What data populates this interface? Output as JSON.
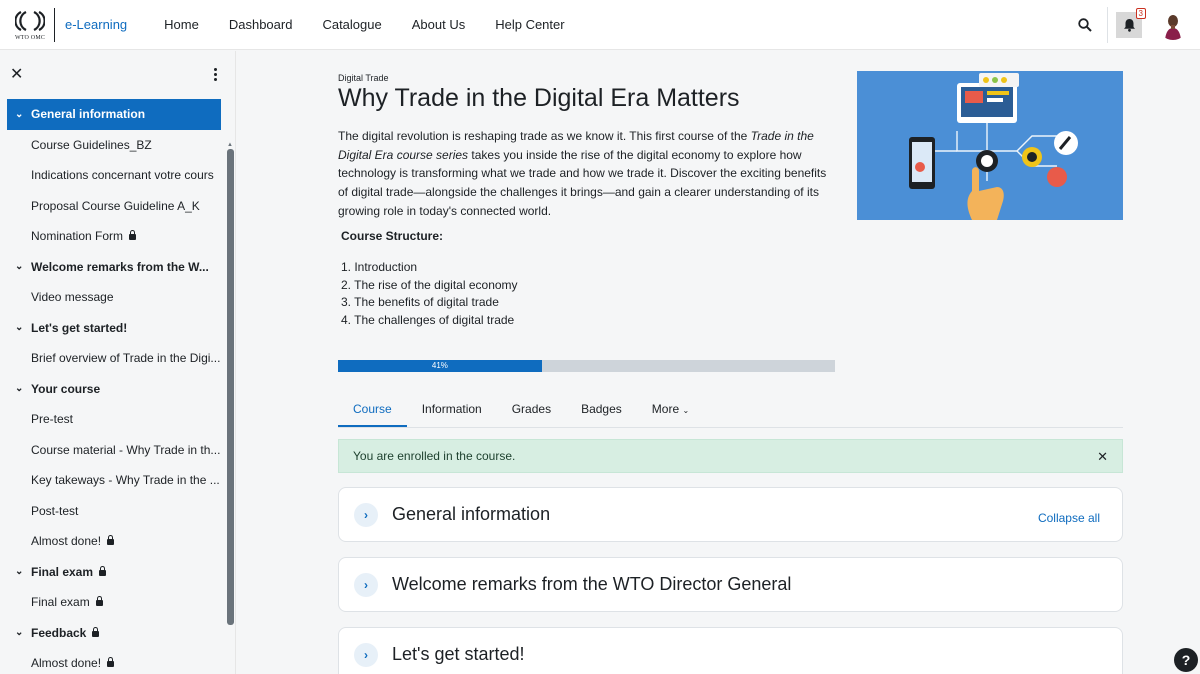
{
  "navbar": {
    "logo_small_text": "WTO OMC",
    "brand": "e-Learning",
    "links": [
      "Home",
      "Dashboard",
      "Catalogue",
      "About Us",
      "Help Center"
    ],
    "notification_count": "3"
  },
  "drawer": {
    "items": [
      {
        "type": "section",
        "label": "General information",
        "active": true,
        "locked": false
      },
      {
        "type": "activity",
        "label": "Course Guidelines_BZ",
        "locked": false
      },
      {
        "type": "activity",
        "label": "Indications concernant votre cours",
        "locked": false
      },
      {
        "type": "activity",
        "label": "Proposal Course Guideline A_K",
        "locked": false
      },
      {
        "type": "activity",
        "label": "Nomination Form",
        "locked": true
      },
      {
        "type": "section",
        "label": "Welcome remarks from the W...",
        "locked": false
      },
      {
        "type": "activity",
        "label": "Video message",
        "locked": false
      },
      {
        "type": "section",
        "label": "Let's get started!",
        "locked": false
      },
      {
        "type": "activity",
        "label": "Brief overview of Trade in the Digi...",
        "locked": false
      },
      {
        "type": "section",
        "label": "Your course",
        "locked": false
      },
      {
        "type": "activity",
        "label": "Pre-test",
        "locked": false
      },
      {
        "type": "activity",
        "label": "Course material - Why Trade in th...",
        "locked": false
      },
      {
        "type": "activity",
        "label": "Key takeways - Why Trade in the ...",
        "locked": false
      },
      {
        "type": "activity",
        "label": "Post-test",
        "locked": false
      },
      {
        "type": "activity",
        "label": "Almost done!",
        "locked": true
      },
      {
        "type": "section",
        "label": "Final exam",
        "locked": true
      },
      {
        "type": "activity",
        "label": "Final exam",
        "locked": true
      },
      {
        "type": "section",
        "label": "Feedback",
        "locked": true
      },
      {
        "type": "activity",
        "label": "Almost done!",
        "locked": true
      }
    ]
  },
  "course": {
    "category": "Digital Trade",
    "title": "Why Trade in the Digital Era Matters",
    "summary_1": "The digital revolution is reshaping trade as we know it. This first course of the ",
    "summary_italic": "Trade in the Digital Era course series",
    "summary_2": " takes you inside the rise of the digital economy to explore how technology is transforming what we trade and how we trade it. Discover the exciting benefits of digital trade—alongside the challenges it brings—and gain a clearer understanding of its growing role in today's connected world.",
    "structure_title": "Course Structure:",
    "structure": [
      "1. Introduction",
      "2. The rise of the digital economy",
      "3. The benefits of digital trade",
      "4. The challenges of digital trade"
    ],
    "progress_label": "41%",
    "progress_value": 0.41
  },
  "tabs": [
    {
      "label": "Course",
      "active": true
    },
    {
      "label": "Information",
      "active": false
    },
    {
      "label": "Grades",
      "active": false
    },
    {
      "label": "Badges",
      "active": false
    },
    {
      "label": "More",
      "active": false,
      "dropdown": true
    }
  ],
  "alert": {
    "message": "You are enrolled in the course."
  },
  "sections": [
    {
      "title": "General information"
    },
    {
      "title": "Welcome remarks from the WTO Director General"
    },
    {
      "title": "Let's get started!"
    }
  ],
  "collapse_all": "Collapse all",
  "help": "?"
}
